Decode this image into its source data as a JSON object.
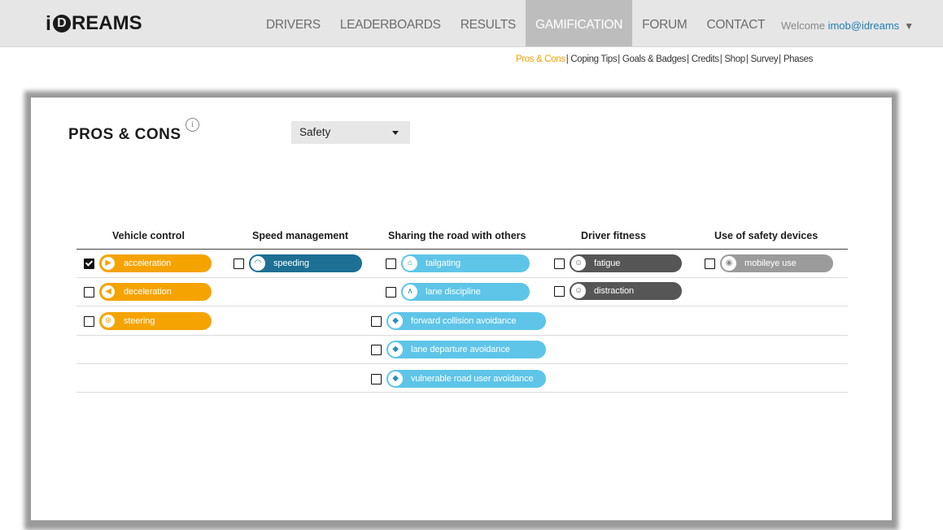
{
  "header": {
    "logo_i": "i",
    "logo_d": "D",
    "logo_rest": "REAMS",
    "nav": [
      {
        "label": "DRIVERS"
      },
      {
        "label": "LEADERBOARDS"
      },
      {
        "label": "RESULTS"
      },
      {
        "label": "GAMIFICATION"
      },
      {
        "label": "FORUM"
      },
      {
        "label": "CONTACT"
      }
    ],
    "active_nav": "GAMIFICATION",
    "welcome_prefix": "Welcome ",
    "user": "imob@idreams",
    "user_caret": "▼"
  },
  "subnav": {
    "items": [
      {
        "label": "Pros & Cons"
      },
      {
        "label": "Coping Tips"
      },
      {
        "label": "Goals & Badges"
      },
      {
        "label": "Credits"
      },
      {
        "label": "Shop"
      },
      {
        "label": "Survey"
      },
      {
        "label": "Phases"
      }
    ],
    "active": "Pros & Cons",
    "separator": "|"
  },
  "main": {
    "title": "PROS & CONS",
    "info_icon": "i",
    "category_select": {
      "value": "Safety"
    },
    "columns": [
      {
        "header": "Vehicle control",
        "color": "#f5a300",
        "items": [
          {
            "label": "acceleration",
            "checked": true,
            "icon": "acceleration-icon"
          },
          {
            "label": "deceleration",
            "checked": false,
            "icon": "deceleration-icon"
          },
          {
            "label": "steering",
            "checked": false,
            "icon": "steering-wheel-icon"
          }
        ]
      },
      {
        "header": "Speed management",
        "color": "#1d6f93",
        "items": [
          {
            "label": "speeding",
            "checked": false,
            "icon": "speedometer-icon"
          }
        ]
      },
      {
        "header": "Sharing the road with others",
        "color": "#5ec5e8",
        "items": [
          {
            "label": "tailgating",
            "checked": false,
            "icon": "car-front-icon"
          },
          {
            "label": "lane discipline",
            "checked": false,
            "icon": "road-lanes-icon"
          },
          {
            "label": "forward collision avoidance",
            "checked": false,
            "icon": "collision-icon"
          },
          {
            "label": "lane departure avoidance",
            "checked": false,
            "icon": "lane-departure-icon"
          },
          {
            "label": "vulnerable road user avoidance",
            "checked": false,
            "icon": "pedestrian-icon"
          }
        ]
      },
      {
        "header": "Driver fitness",
        "color": "#565656",
        "items": [
          {
            "label": "fatigue",
            "checked": false,
            "icon": "fatigue-icon"
          },
          {
            "label": "distraction",
            "checked": false,
            "icon": "distraction-icon"
          }
        ]
      },
      {
        "header": "Use of safety devices",
        "color": "#9b9b9b",
        "items": [
          {
            "label": "mobileye use",
            "checked": false,
            "icon": "mobileye-icon"
          }
        ]
      }
    ]
  }
}
